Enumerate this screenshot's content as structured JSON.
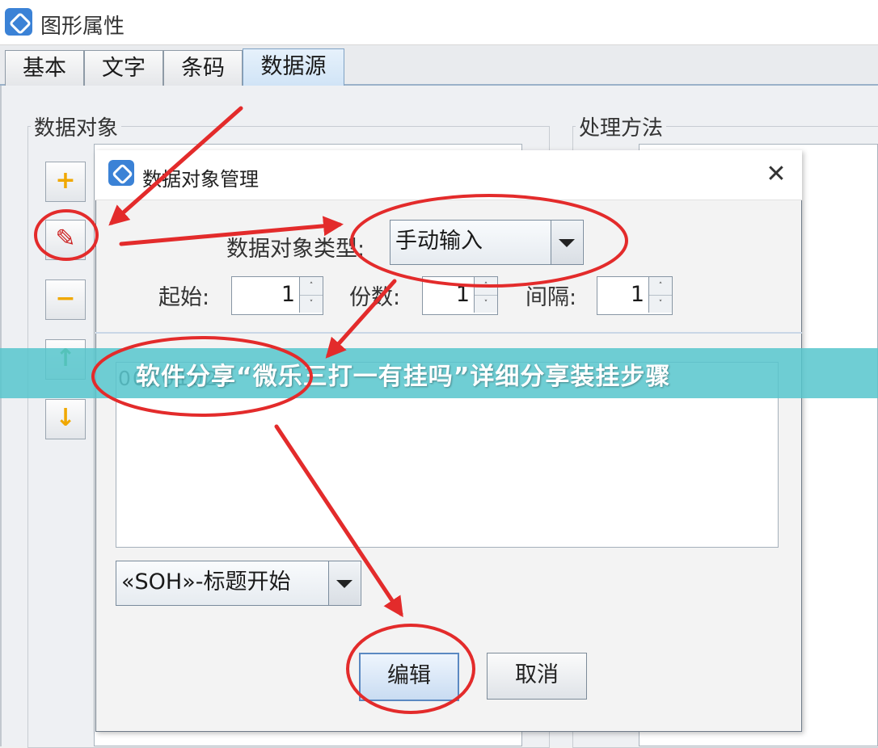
{
  "window": {
    "title": "图形属性",
    "tabs": [
      {
        "label": "基本"
      },
      {
        "label": "文字"
      },
      {
        "label": "条码"
      },
      {
        "label": "数据源"
      }
    ],
    "active_tab": "数据源"
  },
  "left_group": {
    "label": "数据对象",
    "buttons": [
      {
        "name": "add-icon",
        "glyph": "+"
      },
      {
        "name": "edit-icon",
        "glyph": "✎"
      },
      {
        "name": "remove-icon",
        "glyph": "−"
      },
      {
        "name": "move-up-icon",
        "glyph": "↑"
      },
      {
        "name": "move-down-icon",
        "glyph": "↓"
      }
    ]
  },
  "right_group": {
    "label": "处理方法"
  },
  "dialog": {
    "title": "数据对象管理",
    "close_glyph": "✕",
    "type_label": "数据对象类型:",
    "type_value": "手动输入",
    "start_label": "起始:",
    "start_value": "1",
    "copies_label": "份数:",
    "copies_value": "1",
    "interval_label": "间隔:",
    "interval_value": "1",
    "spin_up": "˄",
    "spin_down": "˅",
    "list_item": "00201020",
    "control_char_value": "«SOH»-标题开始",
    "edit_button": "编辑",
    "cancel_button": "取消"
  },
  "banner": {
    "text": "软件分享“微乐三打一有挂吗”详细分享装挂步骤"
  },
  "colors": {
    "annotation_red": "#e32b2b",
    "banner_bg": "#56c6cc",
    "accent_blue": "#3b82d6"
  }
}
